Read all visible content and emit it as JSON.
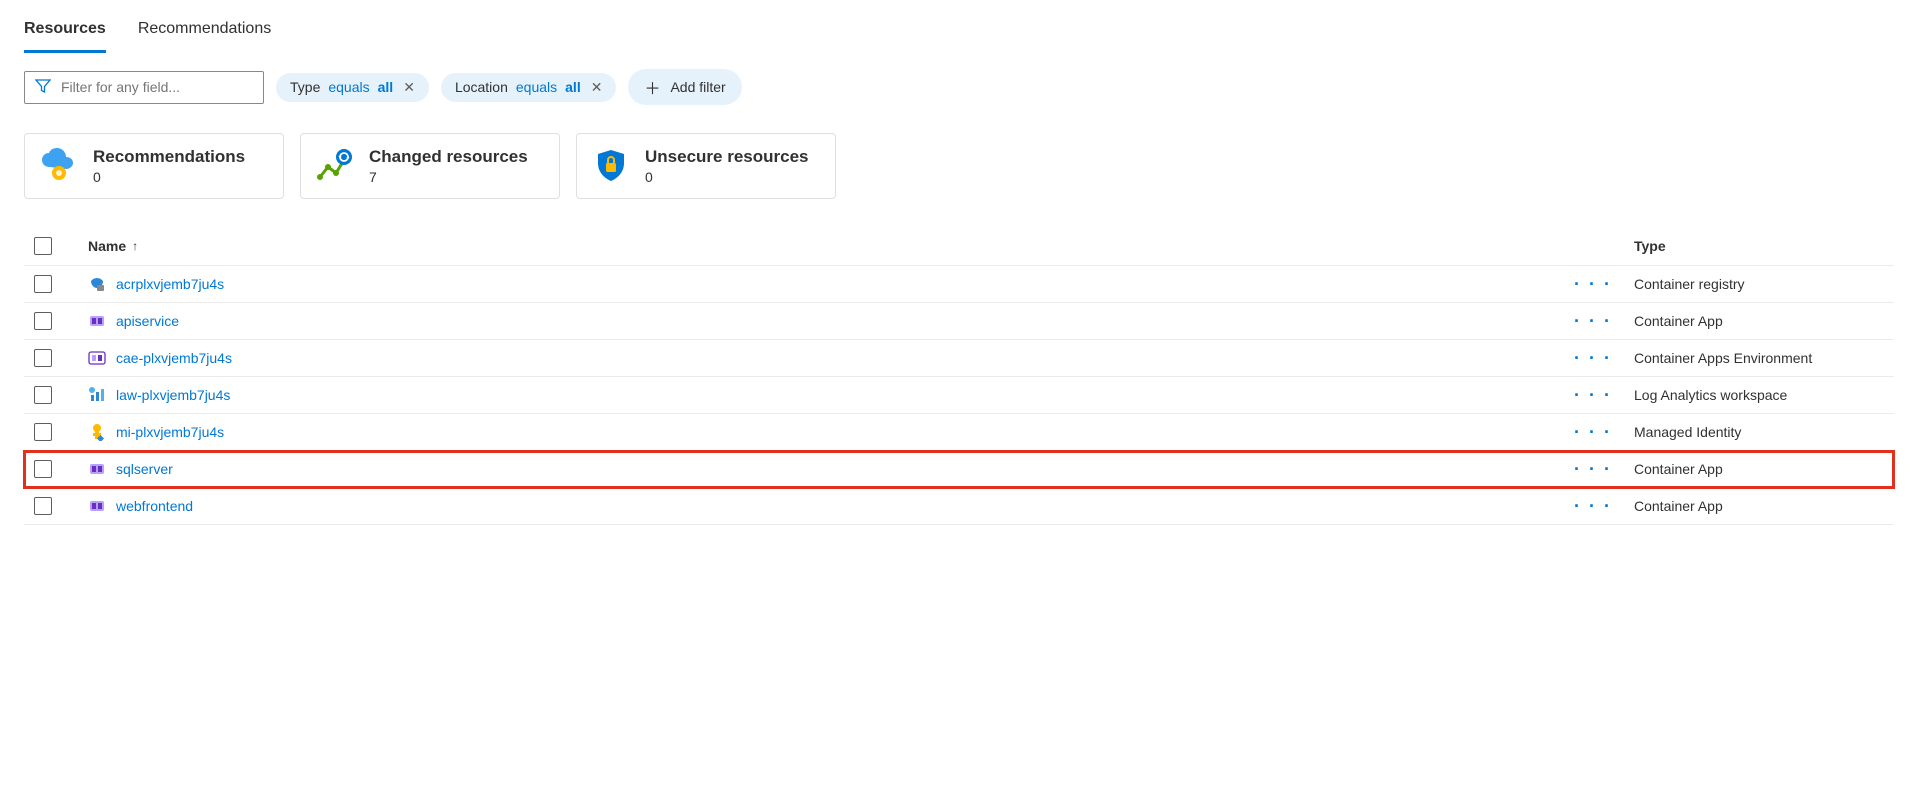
{
  "tabs": {
    "resources": "Resources",
    "recommendations": "Recommendations"
  },
  "filter": {
    "placeholder": "Filter for any field...",
    "type_label": "Type",
    "type_op": "equals",
    "type_val": "all",
    "location_label": "Location",
    "location_op": "equals",
    "location_val": "all",
    "add_filter": "Add filter"
  },
  "cards": {
    "recommendations": {
      "title": "Recommendations",
      "count": "0"
    },
    "changed": {
      "title": "Changed resources",
      "count": "7"
    },
    "unsecure": {
      "title": "Unsecure resources",
      "count": "0"
    }
  },
  "table": {
    "headers": {
      "name": "Name",
      "type": "Type"
    },
    "rows": [
      {
        "name": "acrplxvjemb7ju4s",
        "type": "Container registry",
        "icon": "registry",
        "highlight": false
      },
      {
        "name": "apiservice",
        "type": "Container App",
        "icon": "containerapp",
        "highlight": false
      },
      {
        "name": "cae-plxvjemb7ju4s",
        "type": "Container Apps Environment",
        "icon": "caenv",
        "highlight": false
      },
      {
        "name": "law-plxvjemb7ju4s",
        "type": "Log Analytics workspace",
        "icon": "law",
        "highlight": false
      },
      {
        "name": "mi-plxvjemb7ju4s",
        "type": "Managed Identity",
        "icon": "identity",
        "highlight": false
      },
      {
        "name": "sqlserver",
        "type": "Container App",
        "icon": "containerapp",
        "highlight": true
      },
      {
        "name": "webfrontend",
        "type": "Container App",
        "icon": "containerapp",
        "highlight": false
      }
    ]
  }
}
